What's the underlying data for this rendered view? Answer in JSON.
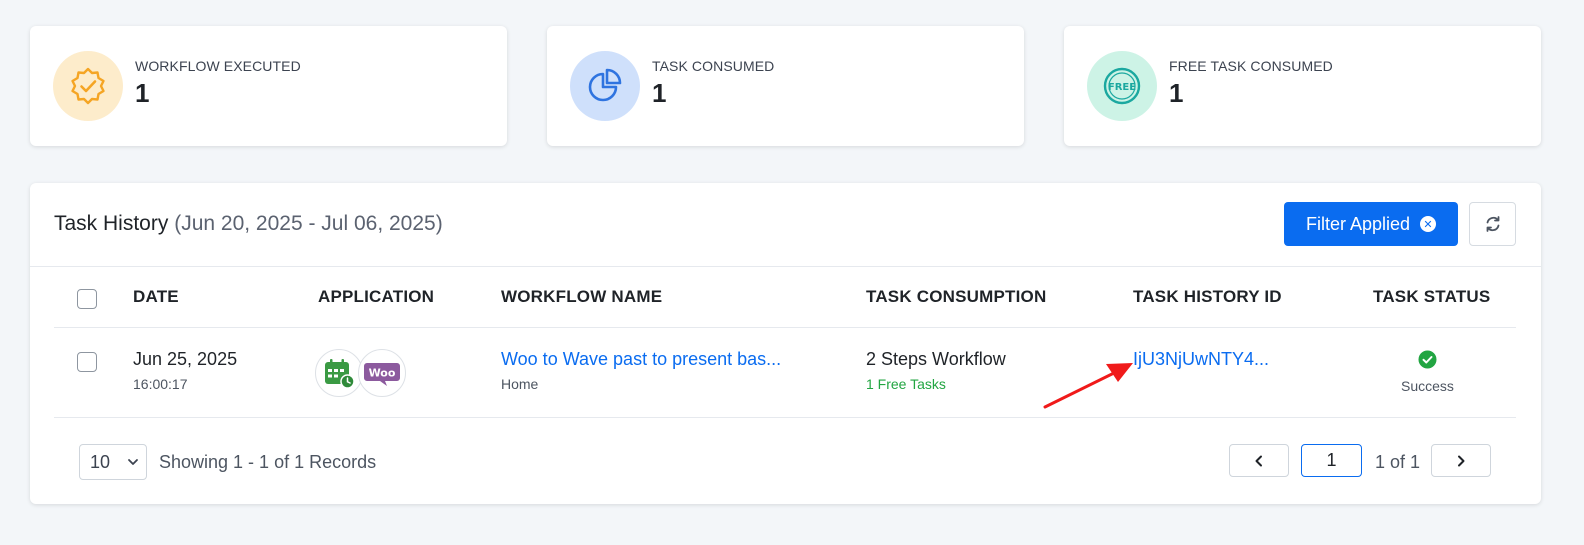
{
  "stats": [
    {
      "label": "WORKFLOW EXECUTED",
      "value": "1",
      "icon": "badge-check-icon",
      "bg": "#fdeccb",
      "color": "#f5a524"
    },
    {
      "label": "TASK CONSUMED",
      "value": "1",
      "icon": "pie-chart-icon",
      "bg": "#cfe0fb",
      "color": "#2f74e0"
    },
    {
      "label": "FREE TASK CONSUMED",
      "value": "1",
      "icon": "free-badge-icon",
      "bg": "#cdf3e6",
      "color": "#1ba8a0",
      "icon_text": "FREE"
    }
  ],
  "task_history": {
    "title": "Task History",
    "range": "(Jun 20, 2025 - Jul 06, 2025)",
    "filter_label": "Filter Applied",
    "filter_clear_glyph": "✕",
    "columns": [
      "DATE",
      "APPLICATION",
      "WORKFLOW NAME",
      "TASK CONSUMPTION",
      "TASK HISTORY ID",
      "TASK STATUS"
    ],
    "rows": [
      {
        "date": "Jun 25, 2025",
        "time": "16:00:17",
        "apps": [
          "calendar-app-icon",
          "woocommerce-icon"
        ],
        "woo_text": "Woo",
        "workflow_name": "Woo to Wave past to present bas...",
        "workflow_folder": "Home",
        "consumption": "2 Steps Workflow",
        "free_tasks": "1 Free Tasks",
        "history_id": "IjU3NjUwNTY4...",
        "status": "Success"
      }
    ]
  },
  "pagination": {
    "page_size": "10",
    "records_text": "Showing 1 - 1 of 1 Records",
    "current_page": "1",
    "page_of": "1 of 1"
  },
  "colors": {
    "accent": "#0a6cf0",
    "success": "#22a542",
    "annotation_arrow": "#f01a1a"
  }
}
